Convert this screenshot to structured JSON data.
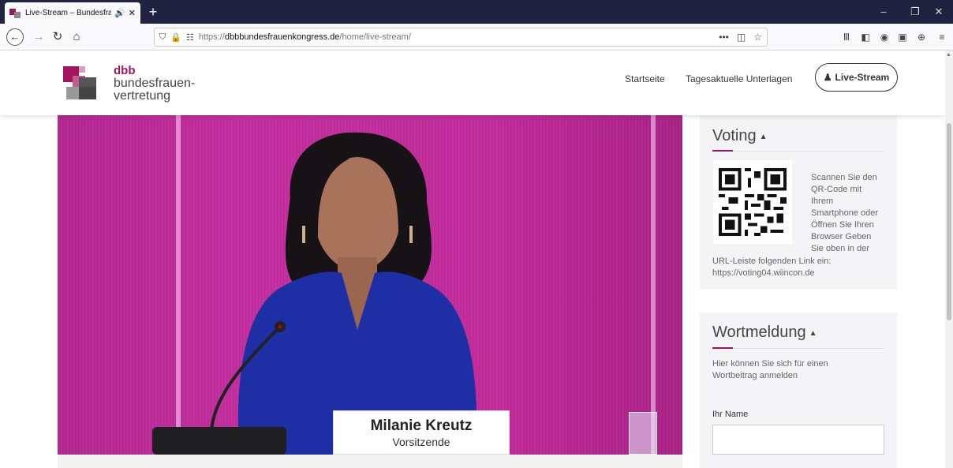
{
  "browser": {
    "tab_title": "Live-Stream – Bundesfrauen",
    "audio_icon": "speaker-icon",
    "new_tab_label": "+",
    "url_prefix": "https://",
    "url_domain": "dbbbundesfrauenkongress.de",
    "url_path": "/home/live-stream/",
    "more_label": "•••"
  },
  "header": {
    "logo_line1": "dbb",
    "logo_line2": "bundesfrauen-",
    "logo_line3": "vertretung",
    "nav": [
      {
        "label": "Startseite"
      },
      {
        "label": "Tagesaktuelle Unterlagen"
      }
    ],
    "live_button": "Live-Stream"
  },
  "video": {
    "speaker_name": "Milanie Kreutz",
    "speaker_role": "Vorsitzende"
  },
  "voting": {
    "title": "Voting",
    "text_line1": "Scannen Sie den",
    "text_line2": "QR-Code mit",
    "text_line3": "Ihrem",
    "text_line4": "Smartphone oder",
    "text_line5": "Öffnen Sie Ihren",
    "text_line6": "Browser Geben",
    "text_line7": "Sie oben in der",
    "text_line8": "URL-Leiste folgenden Link ein:",
    "text_line9": "https://voting04.wiincon.de"
  },
  "wortmeldung": {
    "title": "Wortmeldung",
    "text_line1": "Hier können Sie sich für einen",
    "text_line2": "Wortbeitrag anmelden",
    "name_label": "Ihr Name",
    "name_value": ""
  },
  "colors": {
    "brand": "#a3135e",
    "video_bg": "#bf2a99",
    "dress": "#1e2fa6",
    "titlebar": "#202340"
  }
}
